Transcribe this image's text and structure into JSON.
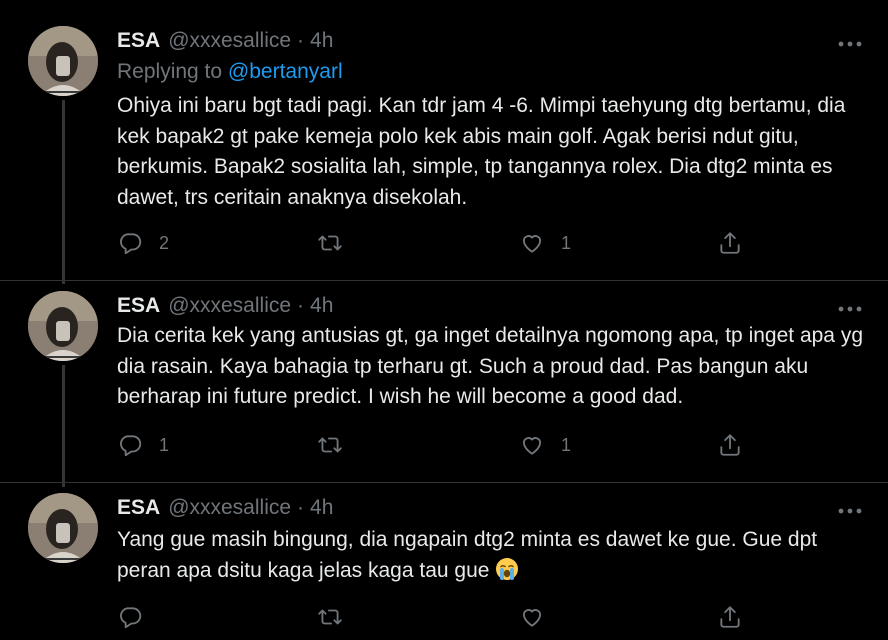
{
  "tweets": [
    {
      "author_name": "ESA",
      "handle": "@xxxesallice",
      "separator": "·",
      "time": "4h",
      "replying_prefix": "Replying to",
      "replying_to": "@bertanyarl",
      "text": "Ohiya ini baru bgt tadi pagi. Kan tdr jam 4 -6. Mimpi taehyung dtg bertamu, dia kek bapak2 gt pake kemeja polo kek abis main golf. Agak berisi ndut gitu, berkumis. Bapak2 sosialita lah, simple, tp tangannya rolex. Dia dtg2 minta es dawet, trs ceritain anaknya disekolah.",
      "reply_count": "2",
      "retweet_count": "",
      "like_count": "1"
    },
    {
      "author_name": "ESA",
      "handle": "@xxxesallice",
      "separator": "·",
      "time": "4h",
      "text": "Dia cerita kek yang antusias gt, ga inget detailnya ngomong apa, tp inget apa yg dia rasain. Kaya bahagia tp terharu gt. Such a proud dad. Pas bangun aku berharap ini future predict. I wish he will become a good dad.",
      "reply_count": "1",
      "retweet_count": "",
      "like_count": "1"
    },
    {
      "author_name": "ESA",
      "handle": "@xxxesallice",
      "separator": "·",
      "time": "4h",
      "text": "Yang gue masih bingung, dia ngapain dtg2 minta es dawet ke gue. Gue dpt peran apa dsitu kaga jelas kaga tau gue",
      "emoji": "loudly-crying-face",
      "reply_count": "",
      "retweet_count": "",
      "like_count": ""
    }
  ],
  "icons": {
    "reply": "reply-icon",
    "retweet": "retweet-icon",
    "like": "heart-icon",
    "share": "share-icon",
    "more": "more-icon"
  },
  "colors": {
    "background": "#000000",
    "text": "#e7e9ea",
    "muted": "#71767b",
    "link": "#1d9bf0",
    "divider": "#2f3336"
  }
}
